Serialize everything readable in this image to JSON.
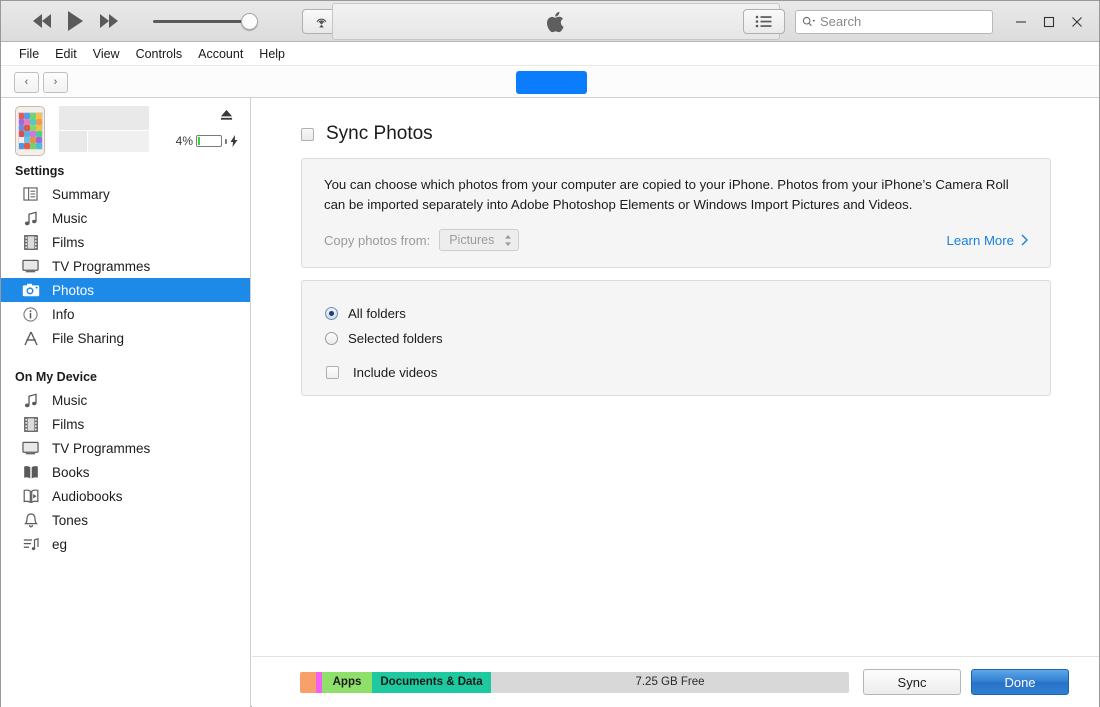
{
  "titlebar": {
    "transport": {
      "rewind": "rewind-button",
      "play": "play-button",
      "fastforward": "fast-forward-button"
    },
    "volume_value": "90",
    "airplay": "airplay-button",
    "apple_logo": "apple-logo",
    "list_view": "list-view-button",
    "search": {
      "placeholder": "Search",
      "value": ""
    },
    "window": {
      "minimize": "—",
      "maximize": "☐",
      "close": "✕"
    }
  },
  "menubar": {
    "items": [
      "File",
      "Edit",
      "View",
      "Controls",
      "Account",
      "Help"
    ]
  },
  "navbar": {
    "back": "‹",
    "forward": "›",
    "highlight_color": "#0b7cfb"
  },
  "sidebar": {
    "device": {
      "name": "",
      "battery_percent": "4%",
      "eject": "eject-button",
      "charging": true
    },
    "settings_header": "Settings",
    "settings_items": [
      {
        "label": "Summary",
        "icon": "summary-icon",
        "selected": false
      },
      {
        "label": "Music",
        "icon": "music-note-icon",
        "selected": false
      },
      {
        "label": "Films",
        "icon": "film-icon",
        "selected": false
      },
      {
        "label": "TV Programmes",
        "icon": "tv-icon",
        "selected": false
      },
      {
        "label": "Photos",
        "icon": "camera-icon",
        "selected": true
      },
      {
        "label": "Info",
        "icon": "info-icon",
        "selected": false
      },
      {
        "label": "File Sharing",
        "icon": "file-sharing-icon",
        "selected": false
      }
    ],
    "device_header": "On My Device",
    "device_items": [
      {
        "label": "Music",
        "icon": "music-note-icon"
      },
      {
        "label": "Films",
        "icon": "film-icon"
      },
      {
        "label": "TV Programmes",
        "icon": "tv-icon"
      },
      {
        "label": "Books",
        "icon": "book-icon"
      },
      {
        "label": "Audiobooks",
        "icon": "audiobook-icon"
      },
      {
        "label": "Tones",
        "icon": "bell-icon"
      },
      {
        "label": "eg",
        "icon": "playlist-icon"
      }
    ],
    "selected_color": "#1e8ae8"
  },
  "main": {
    "sync_photos_label": "Sync Photos",
    "sync_photos_checked": false,
    "description_line1": "You can choose which photos from your computer are copied to your iPhone. Photos from your iPhone’s Camera Roll",
    "description_line2": "can be imported separately into Adobe Photoshop Elements or Windows Import Pictures and Videos.",
    "copy_from_label": "Copy photos from:",
    "copy_from_value": "Pictures",
    "learn_more": "Learn More",
    "learn_more_chevron": "›",
    "learn_more_color": "#1a7fe0",
    "options": [
      {
        "label": "All folders",
        "selected": true
      },
      {
        "label": "Selected folders",
        "selected": false
      }
    ],
    "include_videos_label": "Include videos",
    "include_videos_checked": false
  },
  "footer": {
    "capacity_segments": [
      {
        "label": "",
        "color": "#f8a06a",
        "width": 16
      },
      {
        "label": "",
        "color": "#f25ff2",
        "width": 6
      },
      {
        "label": "Apps",
        "color": "#8fe06a",
        "width": 50
      },
      {
        "label": "Documents & Data",
        "color": "#1fc9a0",
        "width": 119
      }
    ],
    "free_label": "7.25 GB Free",
    "sync_button": "Sync",
    "done_button": "Done"
  }
}
